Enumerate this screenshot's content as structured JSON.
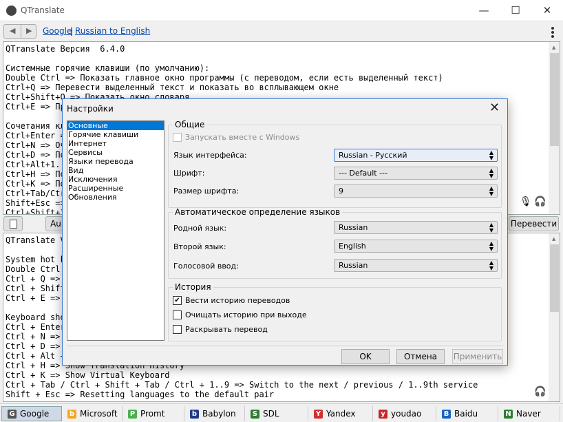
{
  "app": {
    "title": "QTranslate"
  },
  "toolbar": {
    "link_service": "Google",
    "link_direction": "Russian to English"
  },
  "source_text": [
    "QTranslate Версия  6.4.0",
    "",
    "Системные горячие клавиши (по умолчанию):",
    "Double Ctrl => Показать главное окно программы (с переводом, если есть выделенный текст)",
    "Ctrl+Q => Перевести выделенный текст и показать во всплывающем окне",
    "Ctrl+Shift+Q => Показать окно словаря",
    "Ctrl+E => Прос",
    "",
    "Сочетания кла",
    "Ctrl+Enter => П",
    "Ctrl+N => Очи",
    "Ctrl+D => Пока",
    "Ctrl+Alt+1..9 =",
    "Ctrl+H => Пока",
    "Ctrl+K => Пока",
    "Ctrl+Tab/Ctrl+S",
    "Shift+Esc => С",
    "Ctrl+Shift+1..9"
  ],
  "midbar": {
    "auto_label": "Au",
    "translate_button": "Перевести"
  },
  "result_text": [
    "QTranslate Vers",
    "",
    "System hot key",
    "Double Ctrl =>",
    "Ctrl + Q => Tra",
    "Ctrl + Shift + Q",
    "Ctrl + E => List",
    "",
    "Keyboard short",
    "Ctrl + Enter =>",
    "Ctrl + N => Cle",
    "Ctrl + D => Sho",
    "Ctrl + Alt + 1..9",
    "Ctrl + H => Show Translation History",
    "Ctrl + K => Show Virtual Keyboard",
    "Ctrl + Tab / Ctrl + Shift + Tab / Ctrl + 1..9 => Switch to the next / previous / 1..9th service",
    "Shift + Esc => Resetting languages to the default pair"
  ],
  "services": [
    {
      "name": "Google",
      "color": "#555",
      "glyph": "G"
    },
    {
      "name": "Microsoft",
      "color": "#f5a623",
      "glyph": "b"
    },
    {
      "name": "Promt",
      "color": "#4caf50",
      "glyph": "P"
    },
    {
      "name": "Babylon",
      "color": "#1e3a8a",
      "glyph": "b"
    },
    {
      "name": "SDL",
      "color": "#2e7d32",
      "glyph": "S"
    },
    {
      "name": "Yandex",
      "color": "#d32f2f",
      "glyph": "Y"
    },
    {
      "name": "youdao",
      "color": "#c62828",
      "glyph": "y"
    },
    {
      "name": "Baidu",
      "color": "#1565c0",
      "glyph": "B"
    },
    {
      "name": "Naver",
      "color": "#2e7d32",
      "glyph": "N"
    }
  ],
  "dialog": {
    "title": "Настройки",
    "categories": [
      "Основные",
      "Горячие клавиши",
      "Интернет",
      "Сервисы",
      "Языки перевода",
      "Вид",
      "Исключения",
      "Расширенные",
      "Обновления"
    ],
    "general": {
      "legend": "Общие",
      "autostart": "Запускать вместе с Windows",
      "ui_lang_label": "Язык интерфейса:",
      "ui_lang_value": "Russian - Русский",
      "font_label": "Шрифт:",
      "font_value": "--- Default ---",
      "size_label": "Размер шрифта:",
      "size_value": "9"
    },
    "detect": {
      "legend": "Автоматическое определение языков",
      "native_label": "Родной язык:",
      "native_value": "Russian",
      "second_label": "Второй язык:",
      "second_value": "English",
      "voice_label": "Голосовой ввод:",
      "voice_value": "Russian"
    },
    "history": {
      "legend": "История",
      "keep": "Вести историю переводов",
      "clear": "Очищать историю при выходе",
      "expand": "Раскрывать перевод"
    },
    "ok": "OK",
    "cancel": "Отмена",
    "apply": "Применить"
  }
}
